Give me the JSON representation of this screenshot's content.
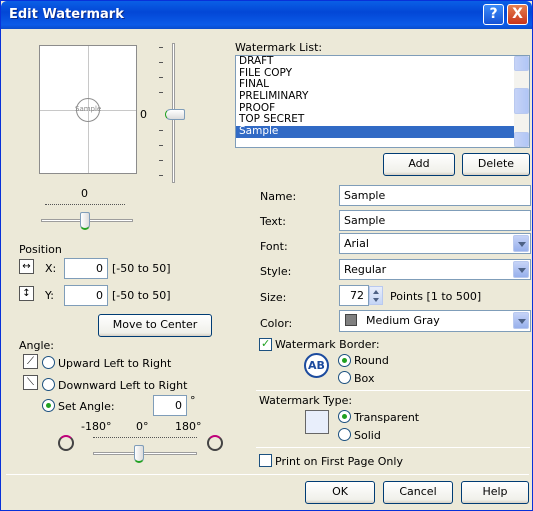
{
  "title": "Edit Watermark",
  "titlebar_buttons": {
    "help": "?",
    "close": "X"
  },
  "preview": {
    "watermark_text": "Sample"
  },
  "vertical_slider": {
    "value": "0"
  },
  "horizontal_slider": {
    "value": "0"
  },
  "position": {
    "heading": "Position",
    "x_label": "X:",
    "x_value": "0",
    "x_range": "[-50 to 50]",
    "y_label": "Y:",
    "y_value": "0",
    "y_range": "[-50 to 50]",
    "move_button": "Move to Center"
  },
  "angle": {
    "heading": "Angle:",
    "upward": "Upward Left to Right",
    "downward": "Downward Left to Right",
    "set_angle": "Set Angle:",
    "set_angle_value": "0",
    "degree": "°",
    "selected": "set_angle",
    "tick_min": "-180°",
    "tick_mid": "0°",
    "tick_max": "180°"
  },
  "watermark_list": {
    "label": "Watermark List:",
    "items": [
      "DRAFT",
      "FILE COPY",
      "FINAL",
      "PRELIMINARY",
      "PROOF",
      "TOP SECRET",
      "Sample"
    ],
    "selected_index": 6,
    "add_button": "Add",
    "delete_button": "Delete"
  },
  "form": {
    "name_label": "Name:",
    "name_value": "Sample",
    "text_label": "Text:",
    "text_value": "Sample",
    "font_label": "Font:",
    "font_value": "Arial",
    "style_label": "Style:",
    "style_value": "Regular",
    "size_label": "Size:",
    "size_value": "72",
    "size_range": "Points [1 to 500]",
    "color_label": "Color:",
    "color_value": "Medium Gray",
    "color_swatch": "#808080"
  },
  "border": {
    "label": "Watermark Border:",
    "checked": true,
    "round": "Round",
    "box": "Box",
    "selected": "round",
    "icon_text": "AB"
  },
  "type": {
    "label": "Watermark Type:",
    "transparent": "Transparent",
    "solid": "Solid",
    "selected": "transparent"
  },
  "first_page_only": {
    "label": "Print on First Page Only",
    "checked": false
  },
  "buttons": {
    "ok": "OK",
    "cancel": "Cancel",
    "help": "Help"
  },
  "colors": {
    "title_bar": "#0a5fe6",
    "selection": "#316ac5",
    "dialog_bg": "#ece9d8"
  }
}
